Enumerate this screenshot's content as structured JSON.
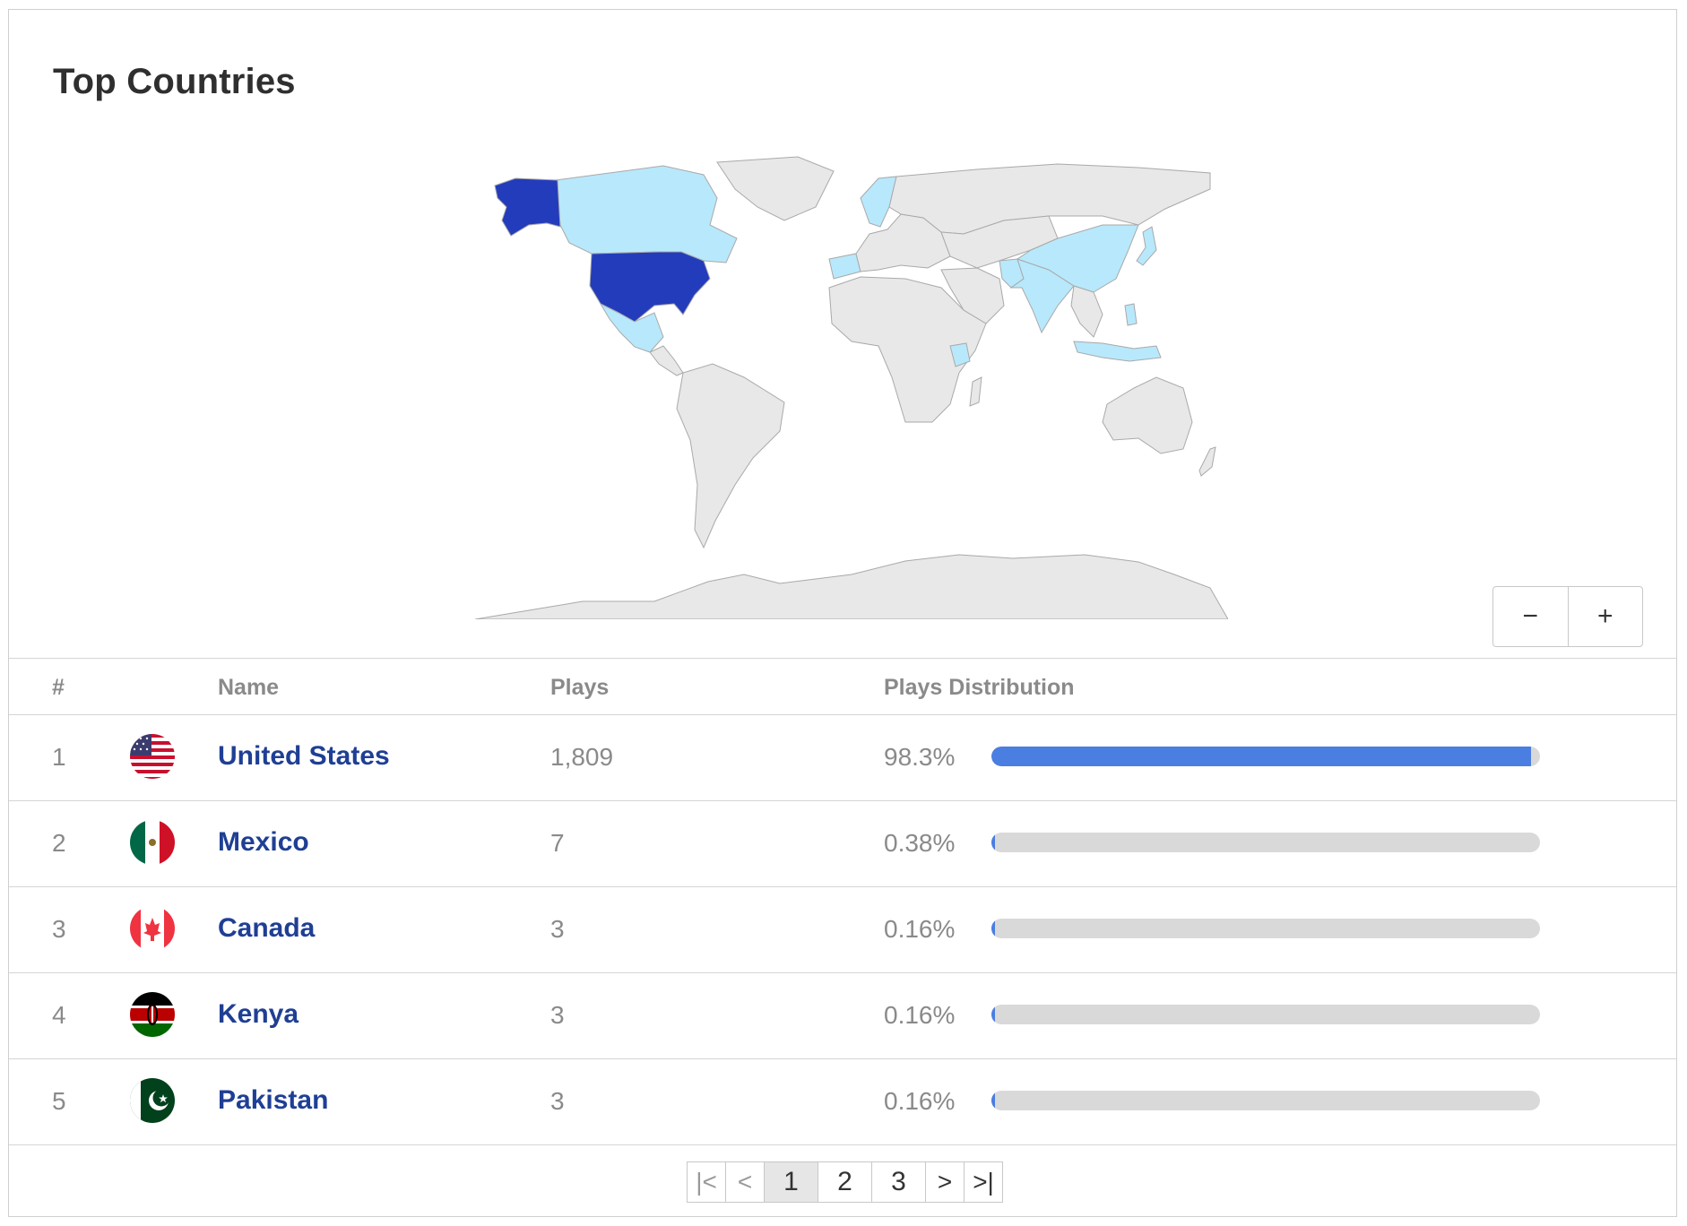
{
  "card": {
    "title": "Top Countries"
  },
  "map": {
    "colors": {
      "top": "#233cbc",
      "highlight": "#b8e8fb",
      "other": "#e8e8e8",
      "border": "#a9a9a9"
    },
    "countries": [
      {
        "name": "United States",
        "level": "top"
      },
      {
        "name": "Canada",
        "level": "highlight"
      },
      {
        "name": "Mexico",
        "level": "highlight"
      },
      {
        "name": "Kenya",
        "level": "highlight"
      },
      {
        "name": "Pakistan",
        "level": "highlight"
      },
      {
        "name": "India",
        "level": "highlight"
      },
      {
        "name": "China",
        "level": "highlight"
      },
      {
        "name": "Japan",
        "level": "highlight"
      },
      {
        "name": "Indonesia",
        "level": "highlight"
      },
      {
        "name": "Philippines",
        "level": "highlight"
      },
      {
        "name": "Portugal",
        "level": "highlight"
      },
      {
        "name": "Sweden",
        "level": "highlight"
      }
    ]
  },
  "zoom": {
    "out_label": "−",
    "in_label": "+"
  },
  "table": {
    "headers": {
      "rank": "#",
      "name": "Name",
      "plays": "Plays",
      "distribution": "Plays Distribution"
    },
    "rows": [
      {
        "rank": "1",
        "name": "United States",
        "plays": "1,809",
        "pct": "98.3%",
        "fraction": 0.983,
        "flag": "us-flag-icon"
      },
      {
        "rank": "2",
        "name": "Mexico",
        "plays": "7",
        "pct": "0.38%",
        "fraction": 0.0038,
        "flag": "mexico-flag-icon"
      },
      {
        "rank": "3",
        "name": "Canada",
        "plays": "3",
        "pct": "0.16%",
        "fraction": 0.0016,
        "flag": "canada-flag-icon"
      },
      {
        "rank": "4",
        "name": "Kenya",
        "plays": "3",
        "pct": "0.16%",
        "fraction": 0.0016,
        "flag": "kenya-flag-icon"
      },
      {
        "rank": "5",
        "name": "Pakistan",
        "plays": "3",
        "pct": "0.16%",
        "fraction": 0.0016,
        "flag": "pakistan-flag-icon"
      }
    ]
  },
  "pagination": {
    "first_icon": "first-page-icon",
    "prev_icon": "prev-page-icon",
    "pages": [
      "1",
      "2",
      "3"
    ],
    "current": "1",
    "next_icon": "next-page-icon",
    "last_icon": "last-page-icon"
  }
}
